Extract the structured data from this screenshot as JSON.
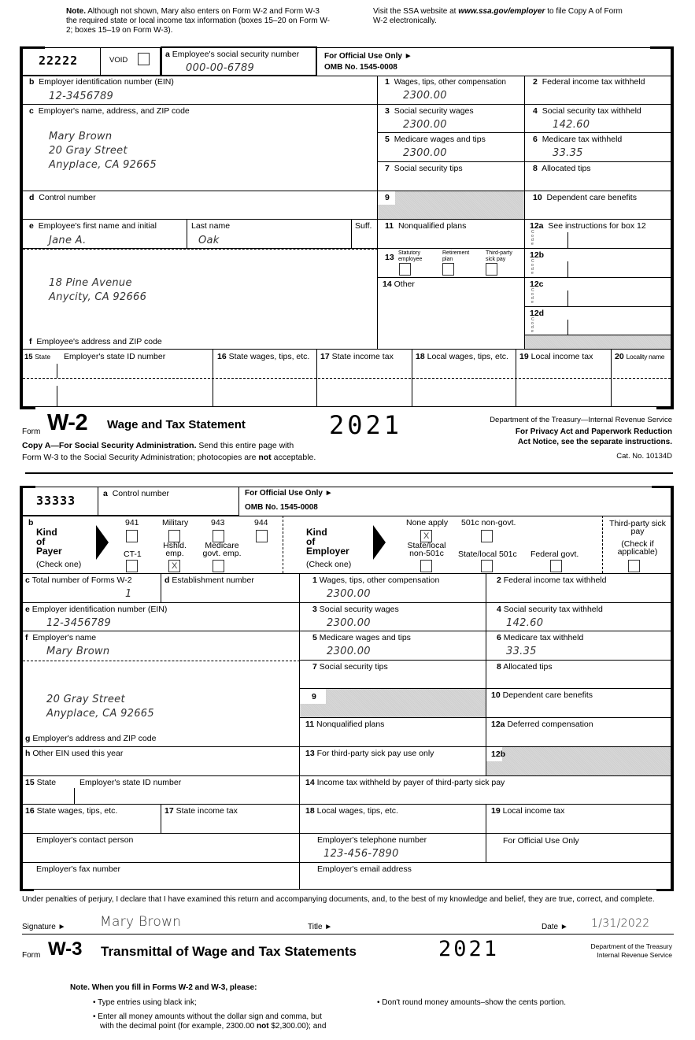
{
  "top_note": {
    "left_bold": "Note.",
    "left_text": " Although not shown, Mary also enters on Form W-2 and Form W-3 the required state or local income tax information (boxes 15–20 on Form W-2; boxes 15–19 on Form W-3).",
    "right_prefix": "Visit the SSA website at ",
    "right_link": "www.ssa.gov/employer",
    "right_suffix": " to file Copy A of Form W-2 electronically."
  },
  "w2": {
    "form_code": "22222",
    "void_label": "VOID",
    "ssn": {
      "label_letter": "a",
      "label": "Employee's social security number",
      "value": "000-00-6789"
    },
    "official_use": "For Official Use Only ►",
    "omb": "OMB No. 1545-0008",
    "b": {
      "letter": "b",
      "label": "Employer identification number (EIN)",
      "value": "12-3456789"
    },
    "c": {
      "letter": "c",
      "label": "Employer's name, address, and ZIP code",
      "lines": [
        "Mary Brown",
        "20 Gray Street",
        "Anyplace, CA 92665"
      ]
    },
    "d": {
      "letter": "d",
      "label": "Control number",
      "value": ""
    },
    "e": {
      "letter": "e",
      "label": "Employee's first name and initial",
      "value": "Jane A.",
      "last_label": "Last name",
      "last_value": "Oak",
      "suff_label": "Suff."
    },
    "f": {
      "letter": "f",
      "label": "Employee's address and ZIP code",
      "lines": [
        "18 Pine Avenue",
        "Anycity, CA 92666"
      ]
    },
    "boxes": {
      "b1": {
        "num": "1",
        "label": "Wages, tips, other compensation",
        "value": "2300.00"
      },
      "b2": {
        "num": "2",
        "label": "Federal income tax withheld",
        "value": ""
      },
      "b3": {
        "num": "3",
        "label": "Social security wages",
        "value": "2300.00"
      },
      "b4": {
        "num": "4",
        "label": "Social security tax withheld",
        "value": "142.60"
      },
      "b5": {
        "num": "5",
        "label": "Medicare wages and tips",
        "value": "2300.00"
      },
      "b6": {
        "num": "6",
        "label": "Medicare tax withheld",
        "value": "33.35"
      },
      "b7": {
        "num": "7",
        "label": "Social security tips",
        "value": ""
      },
      "b8": {
        "num": "8",
        "label": "Allocated tips",
        "value": ""
      },
      "b9": {
        "num": "9"
      },
      "b10": {
        "num": "10",
        "label": "Dependent care benefits",
        "value": ""
      },
      "b11": {
        "num": "11",
        "label": "Nonqualified plans",
        "value": ""
      },
      "b12a": {
        "num": "12a",
        "label": "See instructions for box 12"
      },
      "b12b": {
        "num": "12b"
      },
      "b12c": {
        "num": "12c"
      },
      "b12d": {
        "num": "12d"
      },
      "code_label": "Code",
      "b13": {
        "num": "13",
        "statutory": "Statutory employee",
        "retirement": "Retirement plan",
        "thirdparty": "Third-party sick pay",
        "statutory_checked": false,
        "retirement_checked": false,
        "thirdparty_checked": false
      },
      "b14": {
        "num": "14",
        "label": "Other"
      }
    },
    "state_row": {
      "b15_num": "15",
      "b15_label": "State",
      "b15_id_label": "Employer's state ID number",
      "b16_num": "16",
      "b16_label": "State wages, tips, etc.",
      "b17_num": "17",
      "b17_label": "State income tax",
      "b18_num": "18",
      "b18_label": "Local wages, tips, etc.",
      "b19_num": "19",
      "b19_label": "Local income tax",
      "b20_num": "20",
      "b20_label": "Locality name"
    },
    "footer": {
      "form_word": "Form",
      "form_name": "W-2",
      "title": "Wage and Tax Statement",
      "year": "2021",
      "dept": "Department of the Treasury—Internal Revenue Service",
      "privacy": "For Privacy Act and Paperwork Reduction",
      "privacy2": "Act Notice, see the separate instructions.",
      "copy_bold": "Copy A—For Social Security Administration.",
      "copy_text": " Send this entire page with",
      "copy_line2a": "Form W-3 to the Social Security Administration; photocopies are ",
      "copy_line2b": "not",
      "copy_line2c": " acceptable.",
      "cat": "Cat. No. 10134D"
    }
  },
  "w3": {
    "form_code": "33333",
    "a": {
      "letter": "a",
      "label": "Control number"
    },
    "official_use": "For Official Use Only ►",
    "omb": "OMB No. 1545-0008",
    "b_letter": "b",
    "kind_payer": {
      "title": [
        "Kind",
        "of",
        "Payer"
      ],
      "hint": "(Check one)",
      "options": [
        {
          "label": "941",
          "checked": false
        },
        {
          "label": "Military",
          "checked": false
        },
        {
          "label": "943",
          "checked": false
        },
        {
          "label": "944",
          "checked": false
        },
        {
          "label": "CT-1",
          "checked": false
        },
        {
          "label": "Hshld. emp.",
          "checked": true
        },
        {
          "label": "Medicare govt. emp.",
          "checked": false
        }
      ]
    },
    "kind_employer": {
      "title": [
        "Kind",
        "of",
        "Employer"
      ],
      "hint": "(Check one)",
      "options": [
        {
          "label": "None apply",
          "checked": true
        },
        {
          "label": "501c non-govt.",
          "checked": false
        },
        {
          "label": "State/local non-501c",
          "checked": false
        },
        {
          "label": "State/local 501c",
          "checked": false
        },
        {
          "label": "Federal govt.",
          "checked": false
        }
      ]
    },
    "third_party": {
      "label": "Third-party sick pay",
      "hint": "(Check if applicable)",
      "checked": false
    },
    "c": {
      "letter": "c",
      "label": "Total number of Forms W-2",
      "value": "1"
    },
    "d": {
      "letter": "d",
      "label": "Establishment number",
      "value": ""
    },
    "e": {
      "letter": "e",
      "label": "Employer identification number (EIN)",
      "value": "12-3456789"
    },
    "f": {
      "letter": "f",
      "label": "Employer's name",
      "value": "Mary Brown"
    },
    "g": {
      "letter": "g",
      "label": "Employer's address and ZIP code",
      "lines": [
        "20 Gray Street",
        "Anyplace, CA 92665"
      ]
    },
    "h": {
      "letter": "h",
      "label": "Other EIN used this year",
      "value": ""
    },
    "boxes": {
      "b1": {
        "num": "1",
        "label": "Wages, tips, other compensation",
        "value": "2300.00"
      },
      "b2": {
        "num": "2",
        "label": "Federal income tax withheld",
        "value": ""
      },
      "b3": {
        "num": "3",
        "label": "Social security wages",
        "value": "2300.00"
      },
      "b4": {
        "num": "4",
        "label": "Social security tax withheld",
        "value": "142.60"
      },
      "b5": {
        "num": "5",
        "label": "Medicare wages and tips",
        "value": "2300.00"
      },
      "b6": {
        "num": "6",
        "label": "Medicare tax withheld",
        "value": "33.35"
      },
      "b7": {
        "num": "7",
        "label": "Social security tips",
        "value": ""
      },
      "b8": {
        "num": "8",
        "label": "Allocated tips",
        "value": ""
      },
      "b9": {
        "num": "9"
      },
      "b10": {
        "num": "10",
        "label": "Dependent care benefits",
        "value": ""
      },
      "b11": {
        "num": "11",
        "label": "Nonqualified plans",
        "value": ""
      },
      "b12a": {
        "num": "12a",
        "label": "Deferred compensation",
        "value": ""
      },
      "b12b": {
        "num": "12b"
      },
      "b13": {
        "num": "13",
        "label": "For third-party sick pay use only"
      },
      "b14": {
        "num": "14",
        "label": "Income tax withheld by payer of third-party sick pay"
      },
      "b15": {
        "num": "15",
        "label": "State",
        "id_label": "Employer's state ID number"
      },
      "b16": {
        "num": "16",
        "label": "State wages, tips, etc."
      },
      "b17": {
        "num": "17",
        "label": "State income tax"
      },
      "b18": {
        "num": "18",
        "label": "Local wages, tips, etc."
      },
      "b19": {
        "num": "19",
        "label": "Local income tax"
      }
    },
    "contact": {
      "label": "Employer's contact person",
      "value": ""
    },
    "phone": {
      "label": "Employer's telephone number",
      "value": "123-456-7890"
    },
    "official_use2": "For Official Use Only",
    "fax": {
      "label": "Employer's fax number",
      "value": ""
    },
    "email": {
      "label": "Employer's email address",
      "value": ""
    },
    "perjury": "Under penalties of perjury, I declare that I have examined this return and accompanying documents, and, to the best of my knowledge and belief, they are true, correct, and complete.",
    "signature_label": "Signature ►",
    "signature_value": "Mary Brown",
    "title_label": "Title ►",
    "date_label": "Date ►",
    "date_value": "1/31/2022",
    "footer": {
      "form_word": "Form",
      "form_name": "W-3",
      "title": "Transmittal of Wage and Tax Statements",
      "year": "2021",
      "dept1": "Department of the Treasury",
      "dept2": "Internal Revenue Service"
    }
  },
  "bottom_note": {
    "heading": "Note. When you fill in Forms W-2 and W-3, please:",
    "bullets": [
      "• Type entries using black ink;",
      "• Enter all money amounts without the dollar sign and comma, but",
      "with the decimal point (for example, 2300.00 ",
      "not",
      " $2,300.00); and",
      "• Don't round money amounts–show the cents portion."
    ]
  }
}
